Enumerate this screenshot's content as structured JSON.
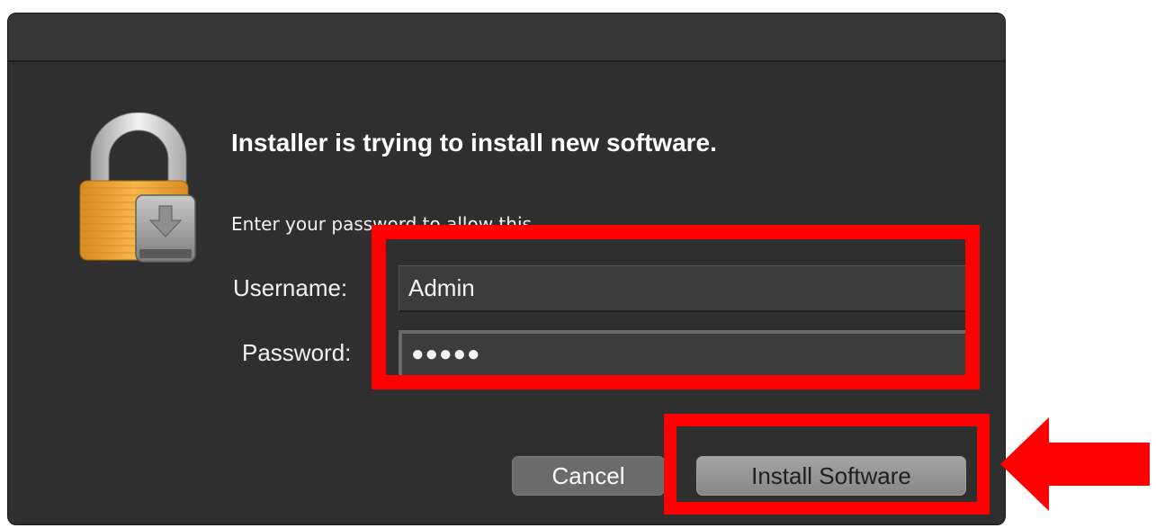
{
  "dialog": {
    "heading": "Installer is trying to install new software.",
    "subtext": "Enter your password to allow this.",
    "icon": "lock-with-installer-disk-icon"
  },
  "form": {
    "username_label": "Username:",
    "username_value": "Admin",
    "password_label": "Password:",
    "password_value": "●●●●●"
  },
  "buttons": {
    "cancel_label": "Cancel",
    "install_label": "Install Software"
  },
  "annotations": {
    "highlight_color": "#ff0000",
    "arrow_icon": "left-arrow-icon"
  },
  "colors": {
    "dialog_background": "#2f2f2f",
    "lock_body": "#f0a93a",
    "lock_shackle": "#d8d8d8"
  }
}
